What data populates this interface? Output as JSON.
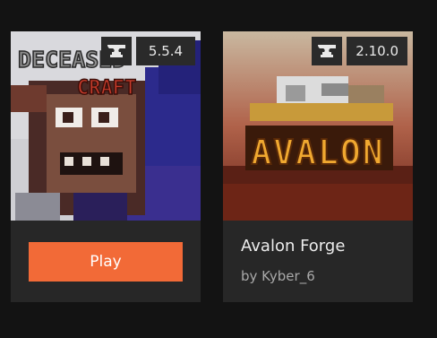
{
  "cards": [
    {
      "art_title": "DECEASED",
      "art_subtitle": "CRAFT",
      "loader_icon": "anvil-icon",
      "version": "5.5.4",
      "action_label": "Play",
      "accent_color": "#f26a37"
    },
    {
      "art_title": "AVALON",
      "loader_icon": "anvil-icon",
      "version": "2.10.0",
      "title": "Avalon Forge",
      "author": "by Kyber_6"
    }
  ]
}
